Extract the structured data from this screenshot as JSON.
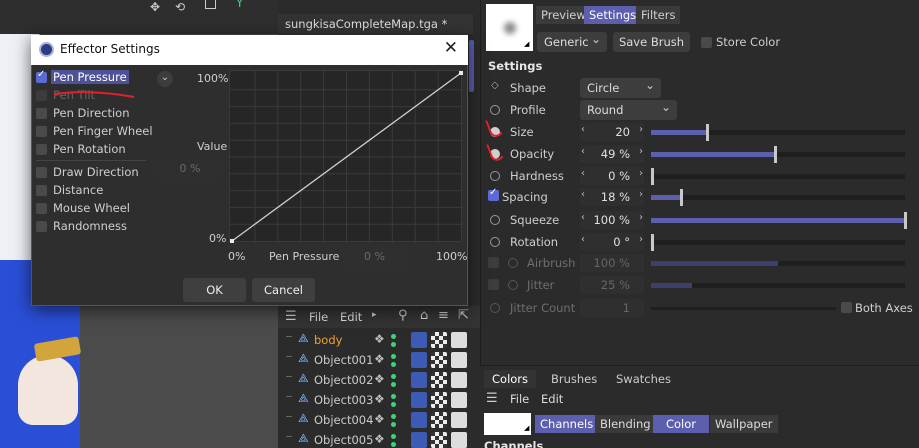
{
  "viewport": {
    "axis_y": "Y"
  },
  "editor_tab": {
    "title": "sungkisaCompleteMap.tga *"
  },
  "object_manager": {
    "menu": [
      "File",
      "Edit"
    ],
    "objects": [
      {
        "name": "body",
        "highlight": true
      },
      {
        "name": "Object001",
        "highlight": false
      },
      {
        "name": "Object002",
        "highlight": false
      },
      {
        "name": "Object003",
        "highlight": false
      },
      {
        "name": "Object004",
        "highlight": false
      },
      {
        "name": "Object005",
        "highlight": false
      }
    ]
  },
  "attributes": {
    "tabs": [
      "Preview",
      "Settings",
      "Filters"
    ],
    "active_tab": "Settings",
    "preset": "Generic",
    "save_brush": "Save Brush",
    "store_color": "Store Color",
    "section": "Settings",
    "shape_label": "Shape",
    "shape_value": "Circle",
    "profile_label": "Profile",
    "profile_value": "Round",
    "params": [
      {
        "label": "Size",
        "display": "20",
        "level": 0.22
      },
      {
        "label": "Opacity",
        "display": "49 %",
        "level": 0.49
      },
      {
        "label": "Hardness",
        "display": "0 %",
        "level": 0.0
      },
      {
        "label": "Spacing",
        "display": "18 %",
        "level": 0.12
      },
      {
        "label": "Squeeze",
        "display": "100 %",
        "level": 1.0
      },
      {
        "label": "Rotation",
        "display": "0 °",
        "level": 0.0
      }
    ],
    "disabled_params": [
      {
        "label": "Airbrush",
        "display": "100 %",
        "level": 0.5
      },
      {
        "label": "Jitter",
        "display": "25 %",
        "level": 0.16
      },
      {
        "label": "Jitter Count",
        "display": "1",
        "level": 0.0
      }
    ],
    "both_axes": "Both Axes"
  },
  "bottom_panel": {
    "tabs": [
      "Colors",
      "Brushes",
      "Swatches"
    ],
    "menu": [
      "File",
      "Edit"
    ],
    "color_tabs": [
      "Channels",
      "Blending",
      "Color",
      "Wallpaper"
    ],
    "section": "Channels"
  },
  "dialog": {
    "title": "Effector Settings",
    "options": [
      {
        "label": "Pen Pressure",
        "checked": true,
        "selected": true,
        "enabled": true
      },
      {
        "label": "Pen Tilt",
        "checked": false,
        "selected": false,
        "enabled": false
      },
      {
        "label": "Pen Direction",
        "checked": false,
        "selected": false,
        "enabled": true
      },
      {
        "label": "Pen Finger Wheel",
        "checked": false,
        "selected": false,
        "enabled": true
      },
      {
        "label": "Pen Rotation",
        "checked": false,
        "selected": false,
        "enabled": true
      },
      {
        "label": "Draw Direction",
        "checked": false,
        "selected": false,
        "enabled": true
      },
      {
        "label": "Distance",
        "checked": false,
        "selected": false,
        "enabled": true
      },
      {
        "label": "Mouse Wheel",
        "checked": false,
        "selected": false,
        "enabled": true
      },
      {
        "label": "Randomness",
        "checked": false,
        "selected": false,
        "enabled": true
      }
    ],
    "value_label": "Value",
    "value_field": "0 %",
    "graph_y_top": "100%",
    "graph_y_bottom": "0%",
    "graph_x_left": "0%",
    "graph_x_right": "100%",
    "graph_x_caption": "Pen Pressure",
    "graph_x_field": "0 %",
    "ok": "OK",
    "cancel": "Cancel"
  },
  "chart_data": {
    "type": "line",
    "series": [
      {
        "x": [
          0,
          100
        ],
        "values": [
          0,
          100
        ]
      }
    ],
    "xlim": [
      0,
      100
    ],
    "ylim": [
      0,
      100
    ],
    "grid": true
  },
  "colors": {
    "accent": "#5b5fae",
    "annotation": "#e0202a",
    "status_dot": "#3fd47a",
    "highlight_text": "#f0a030"
  }
}
